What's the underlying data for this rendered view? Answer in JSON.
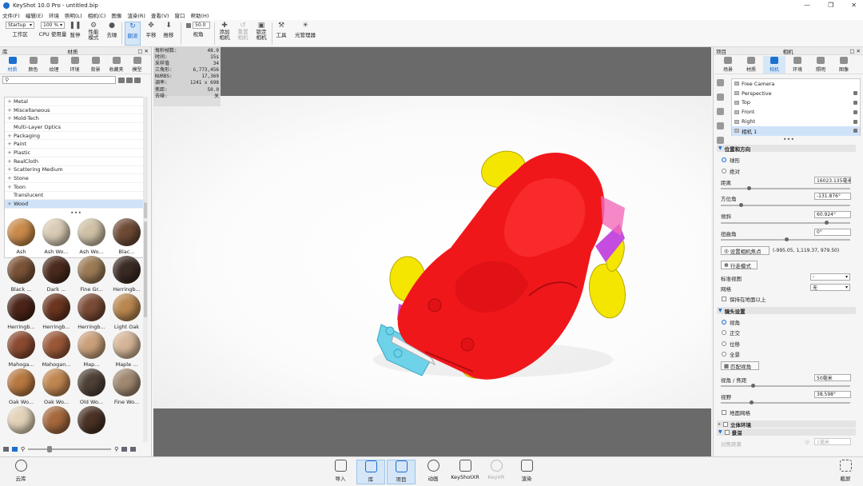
{
  "window": {
    "title": "KeyShot 10.0 Pro  - untitled.bip"
  },
  "menu": [
    "文件(F)",
    "编辑(E)",
    "环境",
    "照明(L)",
    "相机(C)",
    "图像",
    "渲染(R)",
    "查看(V)",
    "窗口",
    "帮助(H)"
  ],
  "toolbar": {
    "workspace_value": "Startup",
    "workspace_label": "工作区",
    "cpu_value": "100 %",
    "cpu_label": "CPU 使用量",
    "pause_label": "暂停",
    "perf_label_line1": "性能",
    "perf_label_line2": "模式",
    "denoise_label": "去噪",
    "tumble_label": "翻滚",
    "pan_label": "平移",
    "dolly_label": "推移",
    "fov_value": "50.0",
    "fov_label": "视角",
    "add_camera_l1": "添加",
    "add_camera_l2": "相机",
    "reset_camera_l1": "重置",
    "reset_camera_l2": "相机",
    "lock_camera_l1": "锁定",
    "lock_camera_l2": "相机",
    "tools_label": "工具",
    "light_manager_label": "光管理器"
  },
  "library": {
    "panel_title": "库",
    "section_title": "材质",
    "tabs": [
      "材质",
      "颜色",
      "纹理",
      "环境",
      "背景",
      "收藏夹",
      "模型"
    ],
    "tree": [
      {
        "label": "Metal",
        "expander": "+"
      },
      {
        "label": "Miscellaneous",
        "expander": "+"
      },
      {
        "label": "Mold-Tech",
        "expander": "+"
      },
      {
        "label": "Multi-Layer Optics",
        "expander": ""
      },
      {
        "label": "Packaging",
        "expander": "+"
      },
      {
        "label": "Paint",
        "expander": "+"
      },
      {
        "label": "Plastic",
        "expander": "+"
      },
      {
        "label": "RealCloth",
        "expander": "+"
      },
      {
        "label": "Scattering Medium",
        "expander": "+"
      },
      {
        "label": "Stone",
        "expander": "+"
      },
      {
        "label": "Toon",
        "expander": "+"
      },
      {
        "label": "Translucent",
        "expander": ""
      },
      {
        "label": "Wood",
        "expander": "+"
      }
    ],
    "thumbnails": [
      {
        "label": "Ash",
        "color": "#c98a4a"
      },
      {
        "label": "Ash Wo...",
        "color": "#d9cbb5"
      },
      {
        "label": "Ash Wo...",
        "color": "#cfc0a6"
      },
      {
        "label": "Blac...",
        "color": "#6e4a35"
      },
      {
        "label": "Black ...",
        "color": "#7a5236"
      },
      {
        "label": "Dark ...",
        "color": "#4a2a1c"
      },
      {
        "label": "Fine Gr...",
        "color": "#9b7a55"
      },
      {
        "label": "Herringb...",
        "color": "#3a2a24"
      },
      {
        "label": "Herringb...",
        "color": "#4b2418"
      },
      {
        "label": "Herringb...",
        "color": "#6b3520"
      },
      {
        "label": "Herringb...",
        "color": "#7a4a35"
      },
      {
        "label": "Light Oak",
        "color": "#b9874f"
      },
      {
        "label": "Mahoga...",
        "color": "#8a4a30"
      },
      {
        "label": "Mahogan...",
        "color": "#9a5838"
      },
      {
        "label": "Map...",
        "color": "#c9a07a"
      },
      {
        "label": "Maple ...",
        "color": "#d5b597"
      },
      {
        "label": "Oak Wo...",
        "color": "#b87840"
      },
      {
        "label": "Oak Wo...",
        "color": "#c08650"
      },
      {
        "label": "Old Wo...",
        "color": "#4e4036"
      },
      {
        "label": "Fine Wo...",
        "color": "#a08870"
      },
      {
        "label": "",
        "color": "#e2d2b8"
      },
      {
        "label": "",
        "color": "#a5683d"
      },
      {
        "label": "",
        "color": "#4a3225"
      }
    ]
  },
  "stats": [
    {
      "k": "每秒帧数:",
      "v": "48.0"
    },
    {
      "k": "时间:",
      "v": "15s"
    },
    {
      "k": "采样值",
      "v": "34"
    },
    {
      "k": "三角形:",
      "v": "6,773,456"
    },
    {
      "k": "NURBS:",
      "v": "17,369"
    },
    {
      "k": "调率:",
      "v": "1241 x 698"
    },
    {
      "k": "焦距:",
      "v": "50.0"
    },
    {
      "k": "去噪:",
      "v": "关"
    }
  ],
  "project": {
    "panel_title": "项目",
    "section_title": "相机",
    "tabs": [
      "场景",
      "材质",
      "相机",
      "环境",
      "照明",
      "图像"
    ],
    "cameras": [
      "Free Camera",
      "Perspective",
      "Top",
      "Front",
      "Right",
      "相机 1"
    ],
    "pos_section": "位置和方向",
    "radio_sphere": "球形",
    "radio_absolute": "绝对",
    "distance_label": "距离",
    "distance_value": "16023.135毫米",
    "azimuth_label": "方位角",
    "azimuth_value": "-131.876°",
    "incl_label": "倾斜",
    "incl_value": "60.924°",
    "twist_label": "扭曲角",
    "twist_value": "0°",
    "set_focus_btn": "设置相机焦点",
    "focus_coords": "(-995.05, 1,119.37, 979.50)",
    "walk_mode_btn": "行走模式",
    "std_view_label": "标准视图",
    "std_view_value": "-",
    "grid_label": "网格",
    "grid_value": "无",
    "keep_above": "保持在地面以上",
    "lens_section": "镜头设置",
    "lens_perspective": "视角",
    "lens_ortho": "正交",
    "lens_shift": "位移",
    "lens_pano": "全景",
    "match_persp_btn": "匹配视角",
    "fov_focal_label": "视角 / 焦距",
    "fov_focal_value": "50毫米",
    "field_label": "视野",
    "field_value": "38.598°",
    "guide_grid": "地面网格",
    "stereo_section": "立体环境",
    "dof_section": "景深",
    "focus_dist_label": "对焦距离",
    "focus_dist_value": "1毫米"
  },
  "bottom": {
    "cloud": "云库",
    "import": "导入",
    "library": "库",
    "project": "项目",
    "animation": "动画",
    "keyshotxr": "KeyShotXR",
    "keyvr": "KeyVR",
    "render": "渲染",
    "screenshot": "截屏"
  },
  "colors": {
    "accent": "#1d6fcf",
    "car_body": "#f0171b",
    "wheels": "#f4e600",
    "accent_parts": "#c44de0",
    "cyan_parts": "#6ed2e8"
  }
}
